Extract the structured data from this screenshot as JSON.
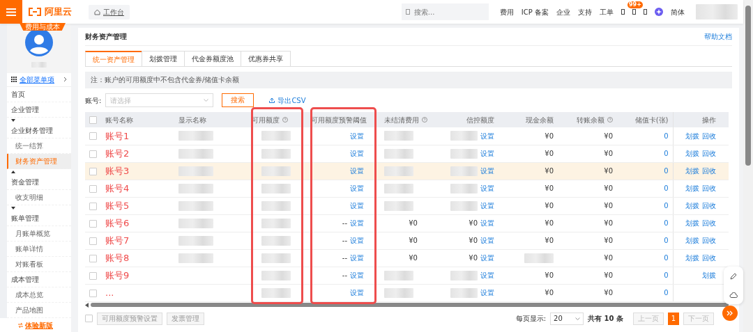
{
  "topbar": {
    "logo": "阿里云",
    "section_badge": "费用与成本",
    "workbench": "工作台",
    "search": {
      "placeholder": "搜索..."
    },
    "links": [
      "费用",
      "ICP 备案",
      "企业",
      "支持",
      "工单"
    ],
    "notification_badge": "99+",
    "language": "简体"
  },
  "sidebar": {
    "all_menu": "全部菜单项",
    "items": [
      {
        "kind": "heading",
        "label": "首页",
        "selected": false
      },
      {
        "kind": "heading",
        "label": "企业管理",
        "selected": false
      },
      {
        "kind": "caret-down"
      },
      {
        "kind": "heading",
        "label": "企业财务管理",
        "selected": false
      },
      {
        "kind": "link",
        "label": "统一结算",
        "selected": false
      },
      {
        "kind": "link",
        "label": "财务资产管理",
        "selected": true
      },
      {
        "kind": "caret-up"
      },
      {
        "kind": "heading",
        "label": "资金管理",
        "selected": false
      },
      {
        "kind": "link",
        "label": "收支明细",
        "selected": false
      },
      {
        "kind": "caret-down"
      },
      {
        "kind": "heading",
        "label": "账单管理",
        "selected": false
      },
      {
        "kind": "link",
        "label": "月账单概览",
        "selected": false
      },
      {
        "kind": "link",
        "label": "账单详情",
        "selected": false
      },
      {
        "kind": "link",
        "label": "对账看板",
        "selected": false
      },
      {
        "kind": "heading",
        "label": "成本管理",
        "selected": false
      },
      {
        "kind": "link",
        "label": "成本总览",
        "selected": false
      },
      {
        "kind": "link",
        "label": "产品地图",
        "selected": false
      }
    ],
    "footer": "体验新版"
  },
  "page": {
    "title": "财务资产管理",
    "help_link": "帮助文档",
    "tabs": [
      {
        "label": "统一资产管理",
        "selected": true
      },
      {
        "label": "划拨管理",
        "selected": false
      },
      {
        "label": "代金券额度池",
        "selected": false
      },
      {
        "label": "优惠券共享",
        "selected": false
      }
    ],
    "note": "注：账户的可用额度中不包含代金券/储值卡余额",
    "filter": {
      "label": "账号:",
      "placeholder": "请选择",
      "search_button": "搜索",
      "export": "导出CSV"
    }
  },
  "table": {
    "select_all_checked": false,
    "columns": [
      {
        "label": "账号名称",
        "help": false,
        "annotated": false
      },
      {
        "label": "显示名称",
        "help": false,
        "annotated": false
      },
      {
        "label": "可用额度",
        "help": true,
        "annotated": true
      },
      {
        "label": "可用额度预警阈值",
        "help": false,
        "annotated": true
      },
      {
        "label": "未结清费用",
        "help": true,
        "annotated": false
      },
      {
        "label": "信控额度",
        "help": false,
        "annotated": false
      },
      {
        "label": "现金余额",
        "help": false,
        "annotated": false
      },
      {
        "label": "转账余额",
        "help": true,
        "annotated": false
      },
      {
        "label": "储值卡(张)",
        "help": false,
        "annotated": false
      },
      {
        "label": "操作",
        "help": false,
        "annotated": false
      }
    ],
    "rows": [
      {
        "checked": false,
        "highlighted": false,
        "name": "账号1",
        "display_name": {
          "blurred": true
        },
        "available": {
          "blurred": true
        },
        "threshold": {
          "link": "设置"
        },
        "unpaid": {
          "blurred": true
        },
        "credit": {
          "blurred": true,
          "link": "设置"
        },
        "cash": "¥0",
        "transfer": "¥0",
        "card": "0",
        "actions": [
          "划拨",
          "回收"
        ]
      },
      {
        "checked": false,
        "highlighted": false,
        "name": "账号2",
        "display_name": {
          "blurred": true
        },
        "available": {
          "blurred": true
        },
        "threshold": {
          "link": "设置"
        },
        "unpaid": {
          "blurred": true
        },
        "credit": {
          "blurred": true,
          "link": "设置"
        },
        "cash": "¥0",
        "transfer": "¥0",
        "card": "0",
        "actions": [
          "划拨",
          "回收"
        ]
      },
      {
        "checked": false,
        "highlighted": true,
        "name": "账号3",
        "display_name": {
          "blurred": true
        },
        "available": {
          "blurred": true
        },
        "threshold": {
          "link": "设置"
        },
        "unpaid": {
          "blurred": true
        },
        "credit": {
          "blurred": true,
          "link": "设置"
        },
        "cash": "¥0",
        "transfer": "¥0",
        "card": "0",
        "actions": [
          "划拨",
          "回收"
        ]
      },
      {
        "checked": false,
        "highlighted": false,
        "name": "账号4",
        "display_name": {
          "blurred": true
        },
        "available": {
          "blurred": true
        },
        "threshold": {
          "link": "设置"
        },
        "unpaid": {
          "blurred": true
        },
        "credit": {
          "blurred": true,
          "link": "设置"
        },
        "cash": "¥0",
        "transfer": "¥0",
        "card": "0",
        "actions": [
          "划拨",
          "回收"
        ]
      },
      {
        "checked": false,
        "highlighted": false,
        "name": "账号5",
        "display_name": {
          "blurred": true
        },
        "available": {
          "blurred": true
        },
        "threshold": {
          "link": "设置"
        },
        "unpaid": {
          "blurred": true
        },
        "credit": {
          "blurred": true,
          "link": "设置"
        },
        "cash": "¥0",
        "transfer": "¥0",
        "card": "0",
        "actions": [
          "划拨",
          "回收"
        ]
      },
      {
        "checked": false,
        "highlighted": false,
        "name": "账号6",
        "display_name": {
          "blurred": true
        },
        "available": {
          "blurred": true
        },
        "threshold": {
          "text": "--",
          "link": "设置"
        },
        "unpaid": "¥0",
        "credit": {
          "text": "¥0",
          "link": "设置"
        },
        "cash": "¥0",
        "transfer": "¥0",
        "card": "0",
        "actions": [
          "划拨",
          "回收"
        ]
      },
      {
        "checked": false,
        "highlighted": false,
        "name": "账号7",
        "display_name": {
          "blurred": true
        },
        "available": {
          "blurred": true
        },
        "threshold": {
          "text": "--",
          "link": "设置"
        },
        "unpaid": "¥0",
        "credit": {
          "text": "¥0",
          "link": "设置"
        },
        "cash": "¥0",
        "transfer": "¥0",
        "card": "0",
        "actions": [
          "划拨",
          "回收"
        ]
      },
      {
        "checked": false,
        "highlighted": false,
        "name": "账号8",
        "display_name": {
          "blurred": true
        },
        "available": {
          "blurred": true
        },
        "threshold": {
          "text": "--",
          "link": "设置"
        },
        "unpaid": "¥0",
        "credit": {
          "text": "¥0",
          "link": "设置"
        },
        "cash": {
          "blurred": true
        },
        "transfer": "¥0",
        "card": "0",
        "actions": [
          "划拨",
          "回收"
        ]
      },
      {
        "checked": false,
        "highlighted": false,
        "name": "账号9",
        "available": {
          "blurred": true
        },
        "threshold": {
          "text": "--",
          "link": "设置"
        },
        "unpaid": {
          "blurred": true
        },
        "credit": {
          "blurred": true,
          "link": "设置"
        },
        "cash": "¥0",
        "transfer": "¥0",
        "card": "0",
        "actions": [
          "划拨"
        ]
      },
      {
        "checked": false,
        "highlighted": false,
        "name": "...",
        "available": {
          "blurred": true
        },
        "threshold": {
          "link": "设置"
        },
        "unpaid": {
          "blurred": true
        },
        "credit": {
          "blurred": true,
          "link": "设置"
        },
        "cash": "¥0",
        "transfer": "¥0",
        "card": "0",
        "actions": []
      }
    ]
  },
  "footer": {
    "select_all_checked": false,
    "buttons": [
      "可用额度预警设置",
      "发票管理"
    ],
    "page_size_label": "每页显示:",
    "page_size": "20",
    "total": "共有 10 条",
    "prev": "上一页",
    "pages": [
      {
        "label": "1",
        "selected": true
      }
    ],
    "next": "下一页"
  }
}
